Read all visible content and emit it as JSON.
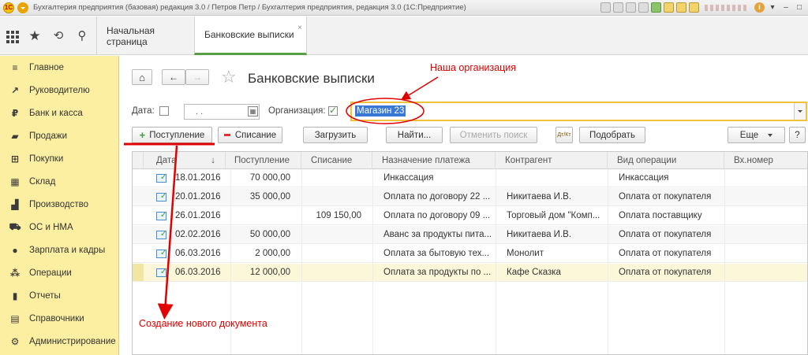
{
  "window": {
    "title": "Бухгалтерия предприятия (базовая) редакция 3.0 / Петров Петр / Бухгалтерия предприятия, редакция 3.0  (1С:Предприятие)"
  },
  "tabs": [
    {
      "label": "Начальная страница"
    },
    {
      "label": "Банковские выписки",
      "close": "×"
    }
  ],
  "sidebar": {
    "items": [
      {
        "label": "Главное",
        "icon": "menu-lines-icon",
        "glyph": "≡"
      },
      {
        "label": "Руководителю",
        "icon": "trend-icon",
        "glyph": "↗"
      },
      {
        "label": "Банк и касса",
        "icon": "ruble-coin-icon",
        "glyph": "₽"
      },
      {
        "label": "Продажи",
        "icon": "bag-icon",
        "glyph": "▰"
      },
      {
        "label": "Покупки",
        "icon": "cart-icon",
        "glyph": "⊞"
      },
      {
        "label": "Склад",
        "icon": "warehouse-icon",
        "glyph": "▦"
      },
      {
        "label": "Производство",
        "icon": "factory-icon",
        "glyph": "▟"
      },
      {
        "label": "ОС и НМА",
        "icon": "truck-icon",
        "glyph": "⛟"
      },
      {
        "label": "Зарплата и кадры",
        "icon": "person-icon",
        "glyph": "●"
      },
      {
        "label": "Операции",
        "icon": "operations-icon",
        "glyph": "⁂"
      },
      {
        "label": "Отчеты",
        "icon": "bar-chart-icon",
        "glyph": "▮"
      },
      {
        "label": "Справочники",
        "icon": "books-icon",
        "glyph": "▤"
      },
      {
        "label": "Администрирование",
        "icon": "gear-icon",
        "glyph": "⚙"
      }
    ]
  },
  "page": {
    "title": "Банковские выписки",
    "date_label": "Дата:",
    "date_value": " .  .",
    "org_label": "Организация:",
    "org_value": "Магазин 23"
  },
  "toolbar": {
    "receipt": "Поступление",
    "writeoff": "Списание",
    "load": "Загрузить",
    "find": "Найти...",
    "cancel_search": "Отменить поиск",
    "dtkt": "Дт/Кт",
    "select": "Подобрать",
    "more": "Еще",
    "help": "?"
  },
  "table": {
    "columns": [
      "Дата",
      "Поступление",
      "Списание",
      "Назначение платежа",
      "Контрагент",
      "Вид операции",
      "Вх.номер"
    ],
    "sort_glyph": "↓",
    "rows": [
      {
        "date": "18.01.2016",
        "in": "70 000,00",
        "out": "",
        "purpose": "Инкассация",
        "counterparty": "",
        "op": "Инкассация",
        "num": ""
      },
      {
        "date": "20.01.2016",
        "in": "35 000,00",
        "out": "",
        "purpose": "Оплата по договору 22 ...",
        "counterparty": "Никитаева И.В.",
        "op": "Оплата от покупателя",
        "num": ""
      },
      {
        "date": "26.01.2016",
        "in": "",
        "out": "109 150,00",
        "purpose": "Оплата по договору 09 ...",
        "counterparty": "Торговый дом \"Комп...",
        "op": "Оплата поставщику",
        "num": ""
      },
      {
        "date": "02.02.2016",
        "in": "50 000,00",
        "out": "",
        "purpose": "Аванс за продукты пита...",
        "counterparty": "Никитаева И.В.",
        "op": "Оплата от покупателя",
        "num": ""
      },
      {
        "date": "06.03.2016",
        "in": "2 000,00",
        "out": "",
        "purpose": "Оплата за бытовую тех...",
        "counterparty": "Монолит",
        "op": "Оплата от покупателя",
        "num": ""
      },
      {
        "date": "06.03.2016",
        "in": "12 000,00",
        "out": "",
        "purpose": "Оплата за продукты по ...",
        "counterparty": "Кафе Сказка",
        "op": "Оплата от покупателя",
        "num": ""
      }
    ]
  },
  "annotations": {
    "org": "Наша организация",
    "new_doc": "Создание нового документа",
    "color": "#e00000"
  }
}
